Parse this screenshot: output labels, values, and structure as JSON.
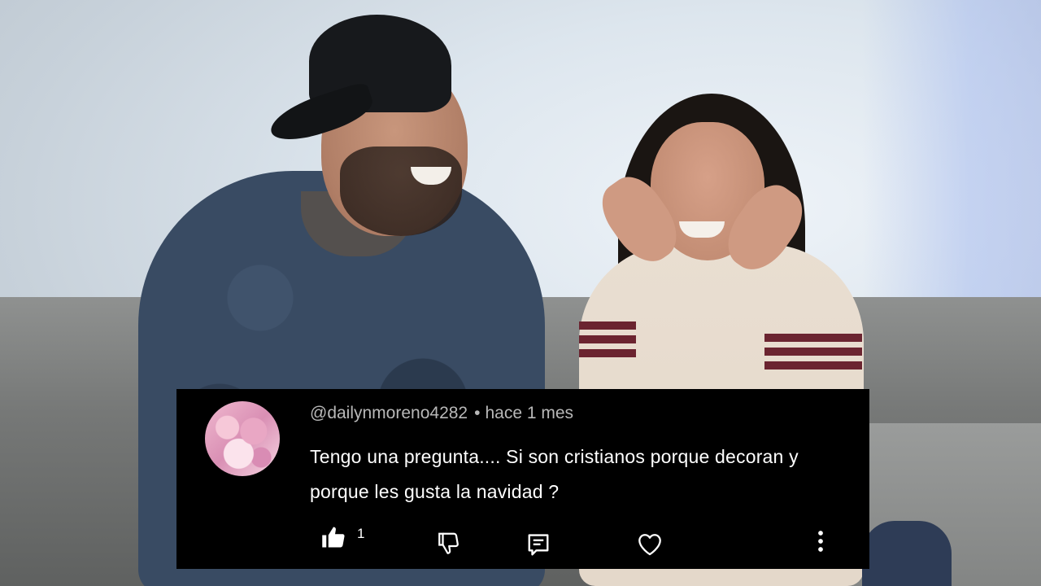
{
  "comment": {
    "username": "@dailynmoreno4282",
    "separator": "•",
    "time": "hace 1 mes",
    "text": "Tengo una pregunta.... Si son cristianos porque decoran y porque les gusta la navidad ?",
    "likes": "1",
    "icons": [
      "thumbs-up-icon",
      "thumbs-down-icon",
      "reply-icon",
      "heart-icon",
      "more-vert-icon"
    ]
  }
}
